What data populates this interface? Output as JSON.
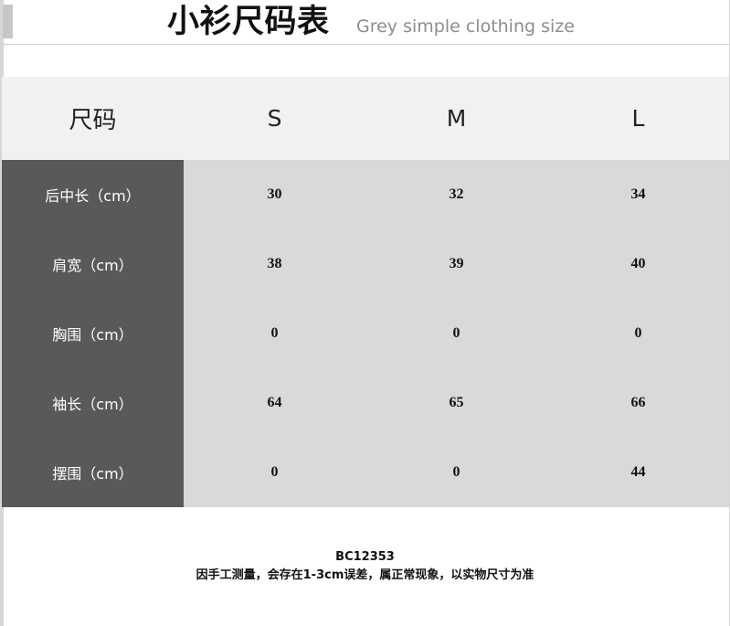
{
  "header": {
    "title": "小衫尺码表",
    "subtitle": "Grey simple clothing size"
  },
  "table": {
    "header_label": "尺码",
    "sizes": [
      "S",
      "M",
      "L"
    ],
    "rows": [
      {
        "label": "后中长（cm）",
        "values": [
          "30",
          "32",
          "34"
        ]
      },
      {
        "label": "肩宽（cm）",
        "values": [
          "38",
          "39",
          "40"
        ]
      },
      {
        "label": "胸围（cm）",
        "values": [
          "0",
          "0",
          "0"
        ]
      },
      {
        "label": "袖长（cm）",
        "values": [
          "64",
          "65",
          "66"
        ]
      },
      {
        "label": "摆围（cm）",
        "values": [
          "0",
          "0",
          "44"
        ]
      }
    ]
  },
  "footnote": {
    "code": "BC12353",
    "note": "因手工测量，会存在1-3cm误差，属正常现象，以实物尺寸为准"
  },
  "colors": {
    "label_bg": "#595959",
    "value_bg": "#d9d9d9",
    "header_bg": "#f1f1f1",
    "subtitle": "#8c8c8c"
  }
}
